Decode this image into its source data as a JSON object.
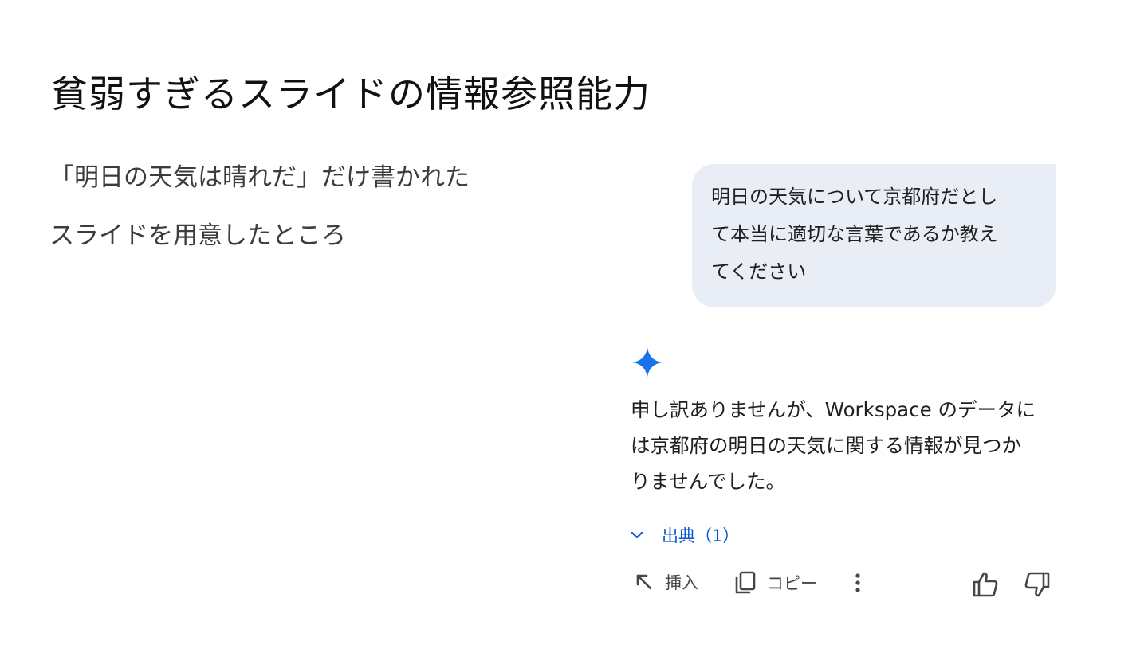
{
  "slide": {
    "title": "貧弱すぎるスライドの情報参照能力",
    "body_lines": [
      "「明日の天気は晴れだ」だけ書かれた",
      "スライドを用意したところ"
    ]
  },
  "chat": {
    "user_message_lines": [
      "明日の天気について京都府だとし",
      "て本当に適切な言葉であるか教え",
      "てください"
    ],
    "response_lines": [
      "申し訳ありませんが、Workspace のデータに",
      "は京都府の明日の天気に関する情報が見つか",
      "りませんでした。"
    ],
    "sources_label": "出典（1）",
    "actions": {
      "insert_label": "挿入",
      "copy_label": "コピー"
    },
    "icons": {
      "sparkle": "gemini-sparkle-icon",
      "chevron": "chevron-down-icon",
      "insert": "insert-arrow-icon",
      "copy": "copy-icon",
      "more": "more-vert-icon",
      "thumbs_up": "thumbs-up-icon",
      "thumbs_down": "thumbs-down-icon"
    },
    "colors": {
      "bubble_bg": "#e9eef6",
      "sparkle": "#1a73e8",
      "link": "#0b57d0"
    }
  }
}
